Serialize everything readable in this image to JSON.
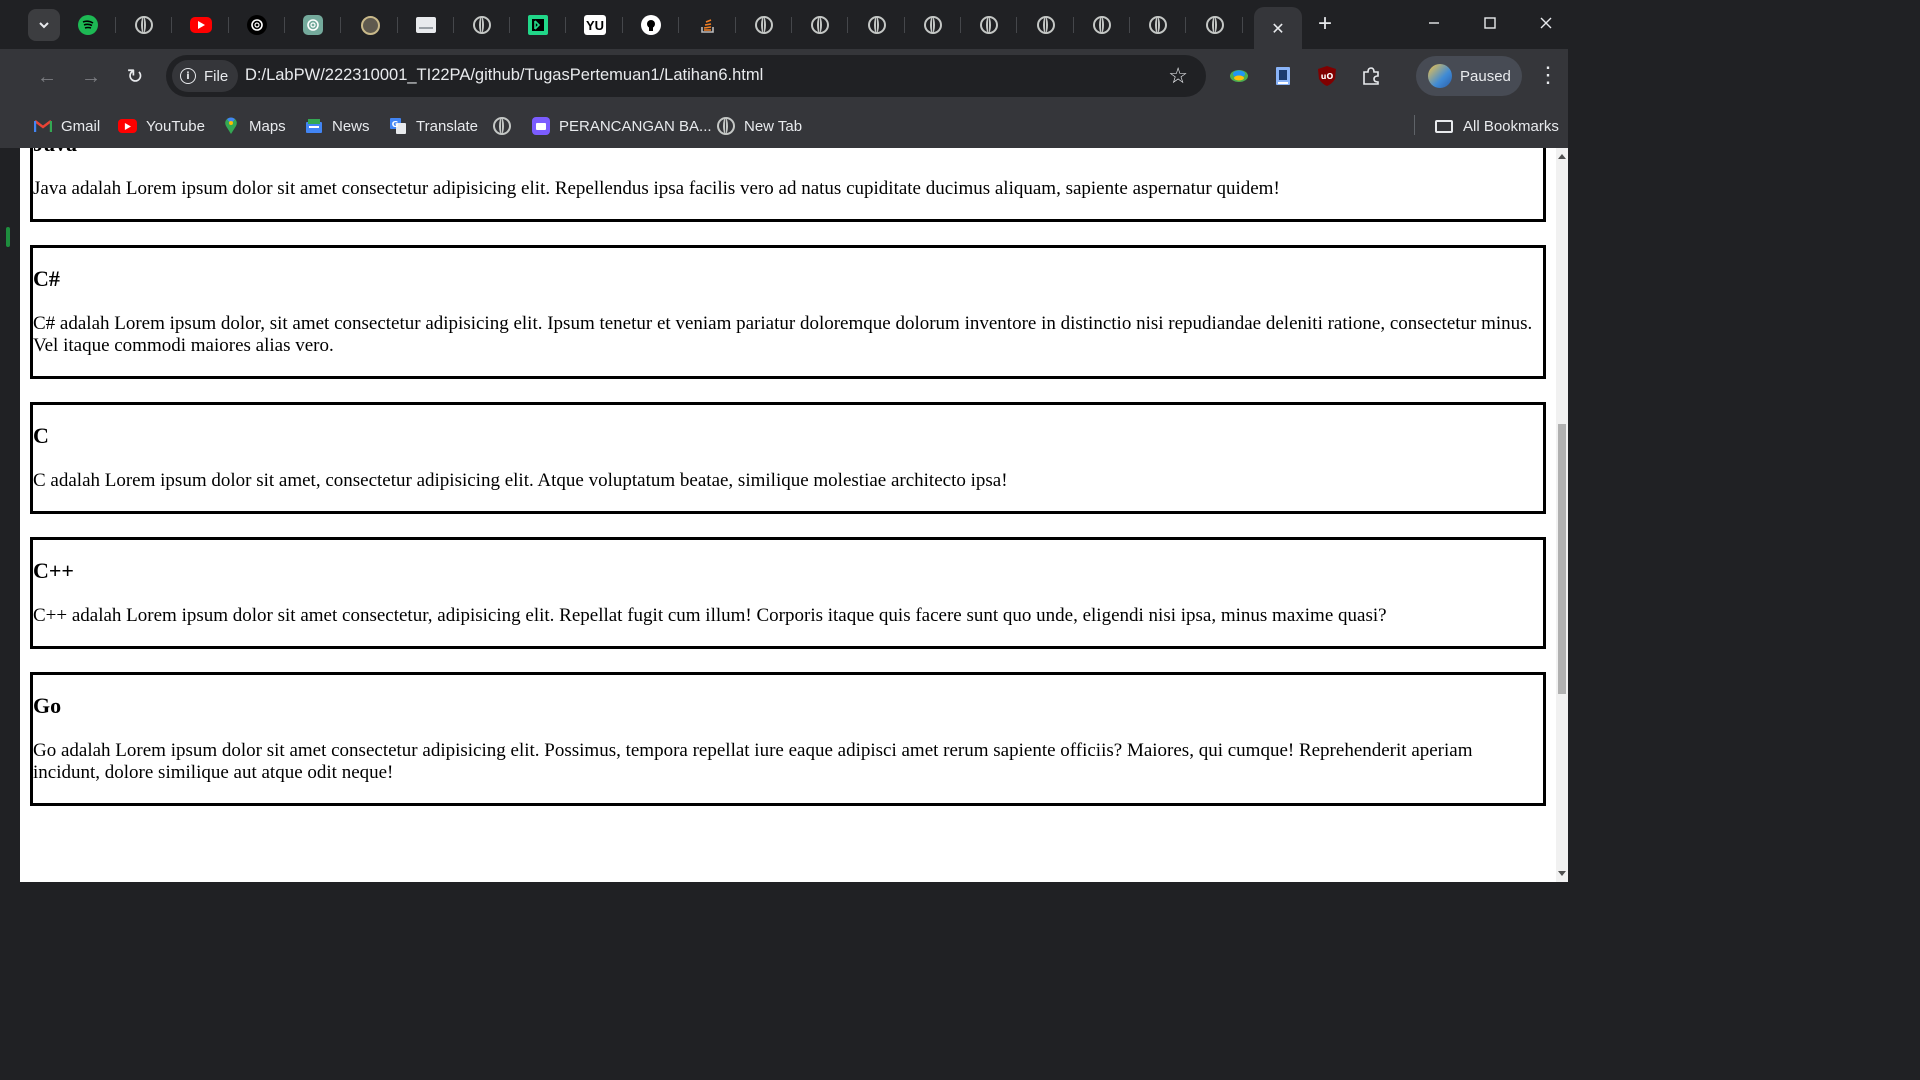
{
  "browser": {
    "tabs": [
      {
        "icon": "spotify-icon"
      },
      {
        "icon": "globe-icon"
      },
      {
        "icon": "youtube-icon"
      },
      {
        "icon": "openai-icon"
      },
      {
        "icon": "chatgpt-icon"
      },
      {
        "icon": "site-icon"
      },
      {
        "icon": "page-icon"
      },
      {
        "icon": "globe-icon"
      },
      {
        "icon": "pycharm-icon"
      },
      {
        "icon": "yu-icon",
        "text": "YU"
      },
      {
        "icon": "github-icon"
      },
      {
        "icon": "stackoverflow-icon"
      },
      {
        "icon": "globe-icon"
      },
      {
        "icon": "globe-icon"
      },
      {
        "icon": "globe-icon"
      },
      {
        "icon": "globe-icon"
      },
      {
        "icon": "globe-icon"
      },
      {
        "icon": "globe-icon"
      },
      {
        "icon": "globe-icon"
      },
      {
        "icon": "globe-icon"
      },
      {
        "icon": "globe-icon"
      }
    ],
    "active_tab_close": "✕",
    "new_tab": "+",
    "window_controls": {
      "minimize": "—",
      "maximize": "☐",
      "close": "✕"
    }
  },
  "toolbar": {
    "back": "←",
    "forward": "→",
    "reload": "↻",
    "chip_label": "File",
    "url": "D:/LabPW/222310001_TI22PA/github/TugasPertemuan1/Latihan6.html",
    "profile_label": "Paused",
    "menu": "⋮"
  },
  "bookmarks": {
    "items": [
      {
        "label": "Gmail",
        "icon": "gmail-icon"
      },
      {
        "label": "YouTube",
        "icon": "youtube-icon"
      },
      {
        "label": "Maps",
        "icon": "maps-icon"
      },
      {
        "label": "News",
        "icon": "news-icon"
      },
      {
        "label": "Translate",
        "icon": "translate-icon"
      },
      {
        "label": "",
        "icon": "globe-icon"
      },
      {
        "label": "PERANCANGAN BA...",
        "icon": "app-icon"
      },
      {
        "label": "New Tab",
        "icon": "globe-icon"
      }
    ],
    "all_bookmarks": "All Bookmarks"
  },
  "page": {
    "sections": [
      {
        "title": "Java",
        "text": "Java adalah Lorem ipsum dolor sit amet consectetur adipisicing elit. Repellendus ipsa facilis vero ad natus cupiditate ducimus aliquam, sapiente aspernatur quidem!"
      },
      {
        "title": "C#",
        "text": "C# adalah Lorem ipsum dolor, sit amet consectetur adipisicing elit. Ipsum tenetur et veniam pariatur doloremque dolorum inventore in distinctio nisi repudiandae deleniti ratione, consectetur minus. Vel itaque commodi maiores alias vero."
      },
      {
        "title": "C",
        "text": "C adalah Lorem ipsum dolor sit amet, consectetur adipisicing elit. Atque voluptatum beatae, similique molestiae architecto ipsa!"
      },
      {
        "title": "C++",
        "text": "C++ adalah Lorem ipsum dolor sit amet consectetur, adipisicing elit. Repellat fugit cum illum! Corporis itaque quis facere sunt quo unde, eligendi nisi ipsa, minus maxime quasi?"
      },
      {
        "title": "Go",
        "text": "Go adalah Lorem ipsum dolor sit amet consectetur adipisicing elit. Possimus, tempora repellat iure eaque adipisci amet rerum sapiente officiis? Maiores, qui cumque! Reprehenderit aperiam incidunt, dolore similique aut atque odit neque!"
      }
    ]
  },
  "colors": {
    "chrome_dark": "#202124",
    "toolbar": "#35363a",
    "page_bg": "#ffffff",
    "border": "#000000"
  }
}
